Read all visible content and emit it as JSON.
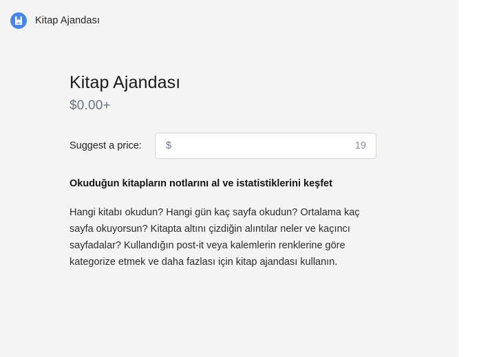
{
  "header": {
    "brand": "Kitap Ajandası",
    "logo_icon": "bookmark-book-icon",
    "logo_color": "#4a86e8"
  },
  "product": {
    "title": "Kitap Ajandası",
    "price": "$0.00+"
  },
  "suggest": {
    "label": "Suggest a price:",
    "currency": "$",
    "placeholder": "19",
    "value": ""
  },
  "description": {
    "headline": "Okuduğun kitapların notlarını al ve istatistiklerini keşfet",
    "body": "Hangi kitabı okudun? Hangi gün kaç sayfa okudun? Ortalama kaç sayfa okuyorsun? Kitapta altını çizdiğin alıntılar neler ve kaçıncı sayfadalar? Kullandığın post-it veya kalemlerin renklerine göre kategorize etmek ve daha fazlası için kitap ajandası kullanın."
  }
}
